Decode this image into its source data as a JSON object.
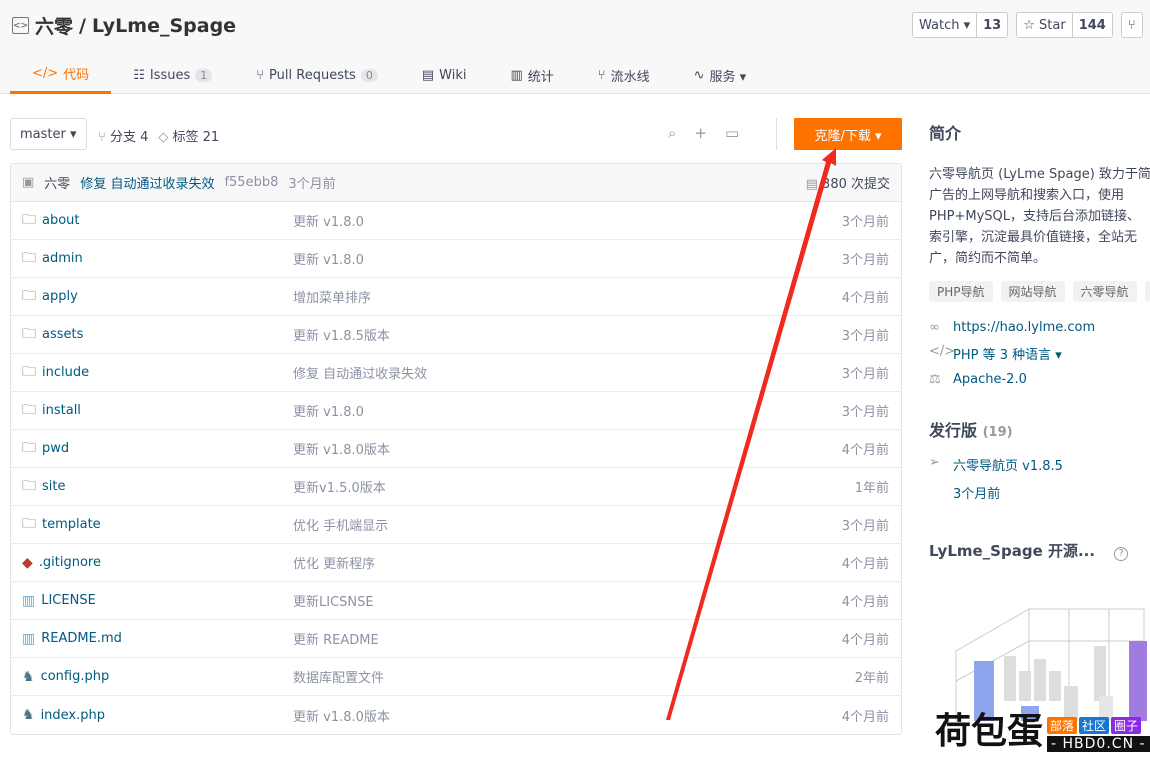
{
  "repo": {
    "owner": "六零",
    "name": "LyLme_Spage",
    "sep": "/"
  },
  "actions": [
    {
      "label": "Watch ▾",
      "count": "13"
    },
    {
      "label": "☆ Star",
      "count": "144"
    },
    {
      "label": "⑂",
      "count": ""
    }
  ],
  "tabs": [
    {
      "label": "代码",
      "icon": "</>",
      "active": true
    },
    {
      "label": "Issues",
      "badge": "1",
      "icon": "☷"
    },
    {
      "label": "Pull Requests",
      "badge": "0",
      "icon": "⑂"
    },
    {
      "label": "Wiki",
      "icon": "▤"
    },
    {
      "label": "统计",
      "icon": "▥"
    },
    {
      "label": "流水线",
      "icon": "⑂"
    },
    {
      "label": "服务 ▾",
      "icon": "∿"
    }
  ],
  "toolbar": {
    "branch": "master ▾",
    "branches": "分支 4",
    "tags": "标签 21",
    "clone": "克隆/下载 ▾"
  },
  "commit": {
    "author": "六零",
    "message": "修复 自动通过收录失效",
    "hash": "f55ebb8",
    "time": "3个月前",
    "count": "380 次提交"
  },
  "files": [
    {
      "name": "about",
      "type": "folder",
      "msg": "更新 v1.8.0",
      "time": "3个月前"
    },
    {
      "name": "admin",
      "type": "folder",
      "msg": "更新 v1.8.0",
      "time": "3个月前"
    },
    {
      "name": "apply",
      "type": "folder",
      "msg": "增加菜单排序",
      "time": "4个月前"
    },
    {
      "name": "assets",
      "type": "folder",
      "msg": "更新 v1.8.5版本",
      "time": "3个月前"
    },
    {
      "name": "include",
      "type": "folder",
      "msg": "修复 自动通过收录失效",
      "time": "3个月前"
    },
    {
      "name": "install",
      "type": "folder",
      "msg": "更新 v1.8.0",
      "time": "3个月前"
    },
    {
      "name": "pwd",
      "type": "folder",
      "msg": "更新 v1.8.0版本",
      "time": "4个月前"
    },
    {
      "name": "site",
      "type": "folder",
      "msg": "更新v1.5.0版本",
      "time": "1年前"
    },
    {
      "name": "template",
      "type": "folder",
      "msg": "优化 手机端显示",
      "time": "3个月前"
    },
    {
      "name": ".gitignore",
      "type": "git",
      "msg": "优化 更新程序",
      "time": "4个月前"
    },
    {
      "name": "LICENSE",
      "type": "doc",
      "msg": "更新LICSNSE",
      "time": "4个月前"
    },
    {
      "name": "README.md",
      "type": "doc",
      "msg": "更新 README",
      "time": "4个月前"
    },
    {
      "name": "config.php",
      "type": "php",
      "msg": "数据库配置文件",
      "time": "2年前"
    },
    {
      "name": "index.php",
      "type": "php",
      "msg": "更新 v1.8.0版本",
      "time": "4个月前"
    }
  ],
  "sidebar": {
    "intro_title": "简介",
    "desc": [
      "六零导航页 (LyLme Spage) 致力于简",
      "广告的上网导航和搜索入口，使用",
      "PHP+MySQL，支持后台添加链接、",
      "索引擎，沉淀最具价值链接，全站无",
      "广，简约而不简单。"
    ],
    "tags": [
      "PHP导航",
      "网站导航",
      "六零导航"
    ],
    "homepage": "https://hao.lylme.com",
    "language": "PHP 等 3 种语言 ▾",
    "license": "Apache-2.0",
    "releases_title": "发行版",
    "releases_count": "(19)",
    "release_name": "六零导航页 v1.8.5",
    "release_time": "3个月前",
    "chart_title": "LyLme_Spage 开源...",
    "help": "?"
  },
  "watermark": {
    "big": "荷包蛋",
    "tags": [
      "部落",
      "社区",
      "圈子"
    ],
    "url": "- HBD0.CN -",
    "colors": [
      "#fe7300",
      "#1677d2",
      "#8a2be2"
    ]
  },
  "colors": {
    "accent": "#fe7300",
    "link": "#005980",
    "arrow": "#f02a1f"
  }
}
